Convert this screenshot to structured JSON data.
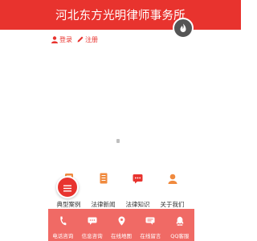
{
  "header": {
    "title": "河北东方光明律师事务所"
  },
  "auth": {
    "login_label": "登录",
    "register_label": "注册"
  },
  "nav": {
    "items": [
      {
        "label": "典型案例",
        "icon": "chat-list-icon"
      },
      {
        "label": "法律新闻",
        "icon": "document-icon"
      },
      {
        "label": "法律知识",
        "icon": "chat-bubble-icon"
      },
      {
        "label": "关于我们",
        "icon": "person-icon"
      }
    ]
  },
  "footer": {
    "items": [
      {
        "label": "电话咨询",
        "icon": "phone-icon"
      },
      {
        "label": "信息咨询",
        "icon": "message-icon"
      },
      {
        "label": "在线地图",
        "icon": "map-pin-icon"
      },
      {
        "label": "在线留言",
        "icon": "comment-icon"
      },
      {
        "label": "QQ客服",
        "icon": "qq-icon"
      }
    ]
  },
  "colors": {
    "brand": "#e8332e",
    "footer_bg": "#f06a65",
    "badge": "#555555"
  }
}
